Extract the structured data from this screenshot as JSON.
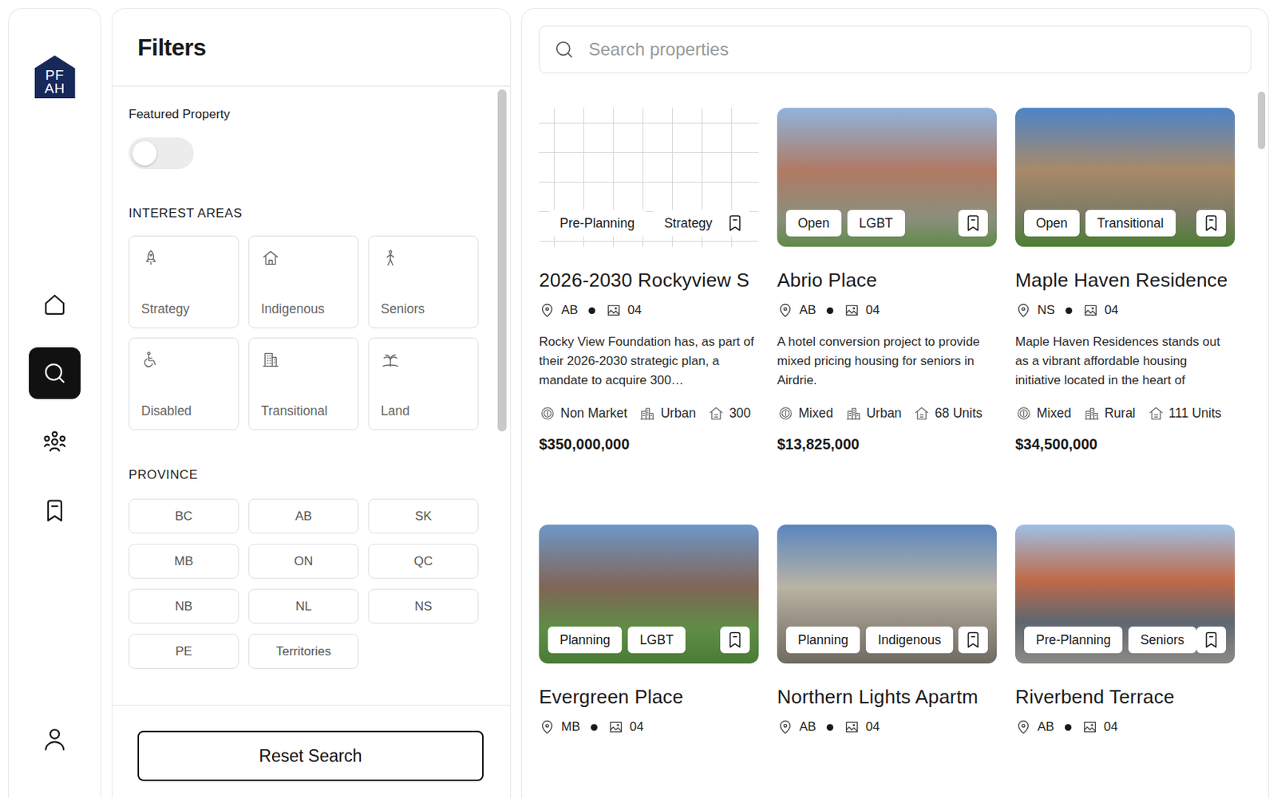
{
  "logo": {
    "line1": "PF",
    "line2": "AH"
  },
  "nav": [
    {
      "kind": "home",
      "selected": false
    },
    {
      "kind": "search",
      "selected": true
    },
    {
      "kind": "community",
      "selected": false
    },
    {
      "kind": "bookmark",
      "selected": false
    }
  ],
  "profile": {
    "kind": "user",
    "selected": false
  },
  "filters": {
    "title": "Filters",
    "featured": {
      "label": "Featured Property",
      "on": false
    },
    "interest_areas": {
      "title": "INTEREST AREAS",
      "items": [
        {
          "label": "Strategy",
          "kind": "rocket",
          "selected": false
        },
        {
          "label": "Indigenous",
          "kind": "house",
          "selected": false
        },
        {
          "label": "Seniors",
          "kind": "person",
          "selected": false
        },
        {
          "label": "Disabled",
          "kind": "wheelchair",
          "selected": false
        },
        {
          "label": "Transitional",
          "kind": "building",
          "selected": false
        },
        {
          "label": "Land",
          "kind": "palm",
          "selected": false
        }
      ]
    },
    "province": {
      "title": "PROVINCE",
      "items": [
        {
          "label": "BC",
          "selected": false
        },
        {
          "label": "AB",
          "selected": false
        },
        {
          "label": "SK",
          "selected": false
        },
        {
          "label": "MB",
          "selected": false
        },
        {
          "label": "ON",
          "selected": false
        },
        {
          "label": "QC",
          "selected": false
        },
        {
          "label": "NB",
          "selected": false
        },
        {
          "label": "NL",
          "selected": false
        },
        {
          "label": "NS",
          "selected": false
        },
        {
          "label": "PE",
          "selected": false
        },
        {
          "label": "Territories",
          "selected": false
        }
      ]
    },
    "reset": "Reset Search"
  },
  "search": {
    "placeholder": "Search properties"
  },
  "properties": [
    {
      "title": "2026-2030 Rockyview S",
      "image": "drawing",
      "tags": [
        "Pre-Planning",
        "Strategy"
      ],
      "saved": false,
      "province": "AB",
      "images": "04",
      "description": "Rocky View Foundation has, as part of their 2026-2030 strategic plan, a mandate to acquire 300…",
      "attributes": [
        {
          "kind": "market",
          "label": "Non Market"
        },
        {
          "kind": "setting",
          "label": "Urban"
        },
        {
          "kind": "units",
          "label": "300"
        }
      ],
      "price": "$350,000,000"
    },
    {
      "title": "Abrio Place",
      "image": "photo",
      "tags": [
        "Open",
        "LGBT"
      ],
      "saved": false,
      "province": "AB",
      "images": "04",
      "description": "A hotel conversion project to provide mixed pricing housing for seniors in Airdrie.",
      "attributes": [
        {
          "kind": "market",
          "label": "Mixed"
        },
        {
          "kind": "setting",
          "label": "Urban"
        },
        {
          "kind": "units",
          "label": "68 Units"
        }
      ],
      "price": "$13,825,000"
    },
    {
      "title": "Maple Haven Residence",
      "image": "photo",
      "tags": [
        "Open",
        "Transitional"
      ],
      "saved": false,
      "province": "NS",
      "images": "04",
      "description": "Maple Haven Residences stands out as a vibrant affordable housing initiative located in the heart of",
      "attributes": [
        {
          "kind": "market",
          "label": "Mixed"
        },
        {
          "kind": "setting",
          "label": "Rural"
        },
        {
          "kind": "units",
          "label": "111 Units"
        }
      ],
      "price": "$34,500,000"
    },
    {
      "title": "Evergreen Place",
      "image": "photo",
      "tags": [
        "Planning",
        "LGBT"
      ],
      "saved": false,
      "province": "MB",
      "images": "04"
    },
    {
      "title": "Northern Lights Apartm",
      "image": "photo",
      "tags": [
        "Planning",
        "Indigenous"
      ],
      "saved": false,
      "province": "AB",
      "images": "04"
    },
    {
      "title": "Riverbend Terrace",
      "image": "photo",
      "tags": [
        "Pre-Planning",
        "Seniors"
      ],
      "saved": false,
      "province": "AB",
      "images": "04"
    }
  ]
}
